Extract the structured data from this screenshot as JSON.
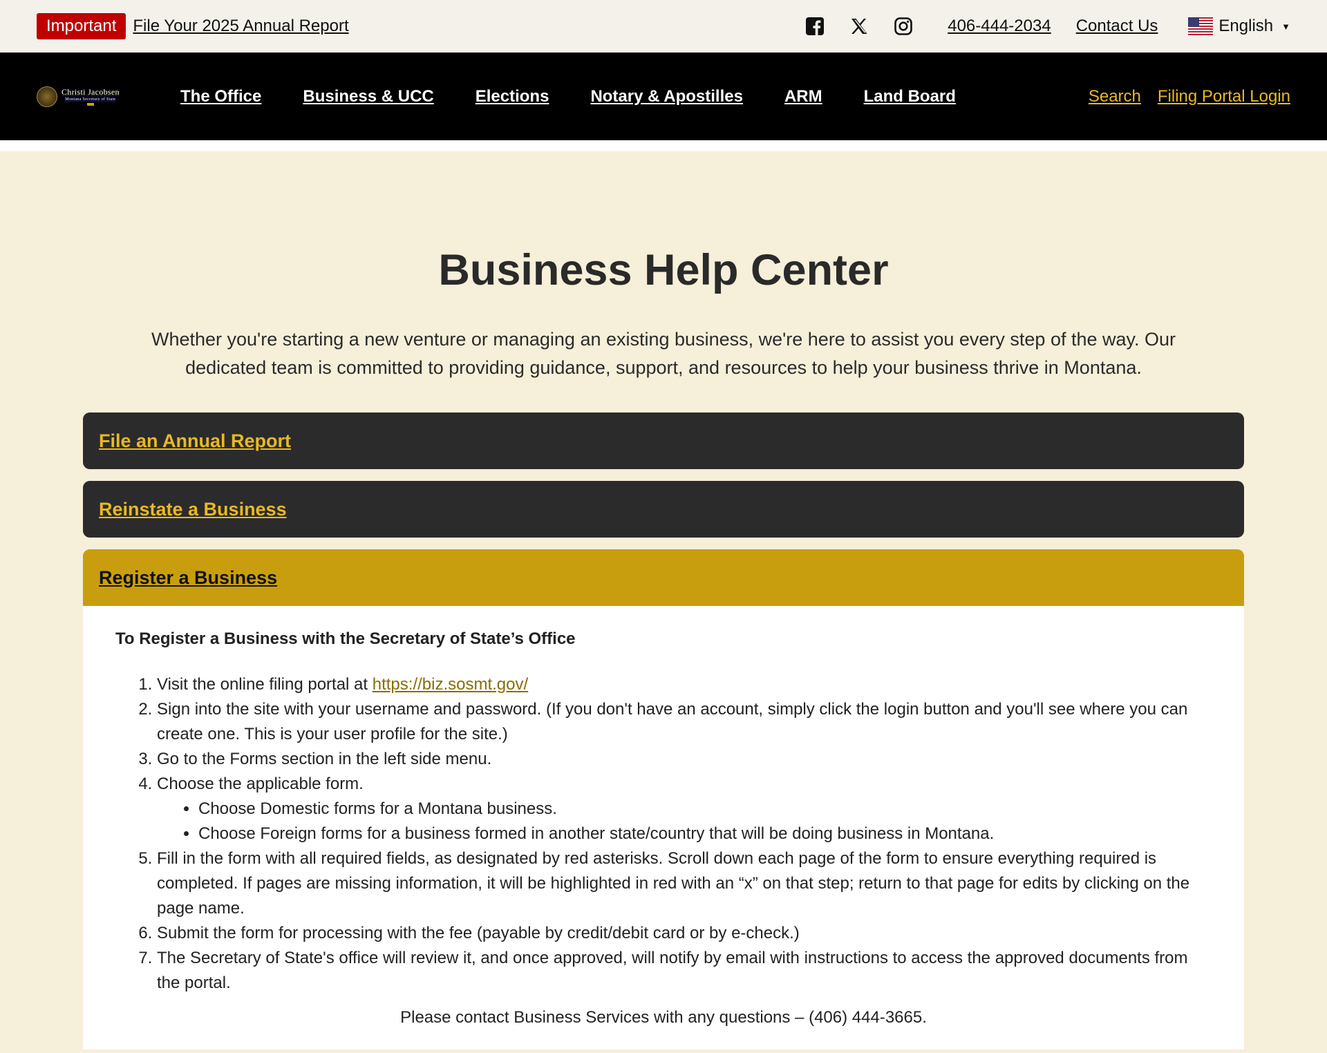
{
  "topbar": {
    "badge": "Important",
    "announcement": "File Your 2025 Annual Report",
    "phone": "406-444-2034",
    "contact": "Contact Us",
    "language": "English"
  },
  "logo": {
    "line1": "Christi Jacobsen",
    "line2": "Montana Secretary of State"
  },
  "nav": {
    "items": [
      "The Office",
      "Business & UCC",
      "Elections",
      "Notary & Apostilles",
      "ARM",
      "Land Board"
    ],
    "search": "Search",
    "portal": "Filing Portal Login"
  },
  "page": {
    "title": "Business Help Center",
    "intro": "Whether you're starting a new venture or managing an existing business, we're here to assist you every step of the way. Our dedicated team is committed to providing guidance, support, and resources to help your business thrive in Montana."
  },
  "accordion": {
    "items": [
      "File an Annual Report",
      "Reinstate a Business",
      "Register a Business"
    ]
  },
  "panel": {
    "heading": "To Register a Business with the Secretary of State’s Office",
    "step1_text": "Visit the online filing portal at ",
    "step1_link": "https://biz.sosmt.gov/",
    "step2": "Sign into the site with your username and password. (If you don't have an account, simply click the login button and you'll see where you can create one. This is your user profile for the site.)",
    "step3": "Go to the Forms section in the left side menu.",
    "step4": "Choose the applicable form.",
    "step4_sub1": "Choose Domestic forms for a Montana business.",
    "step4_sub2": "Choose Foreign forms for a business formed in another state/country that will be doing business in Montana.",
    "step5": "Fill in the form with all required fields, as designated by red asterisks.  Scroll down each page of the form to ensure everything required is completed.  If pages are missing information, it will be highlighted in red with an “x” on that step; return to that page for edits by clicking on the page name.",
    "step6": "Submit the form for processing with the fee (payable by credit/debit card or by e-check.)",
    "step7": "The Secretary of State's office will review it, and once approved, will notify by email with instructions to access the approved documents from the portal.",
    "contact_note": "Please contact Business Services with any questions – (406) 444-3665."
  },
  "colors": {
    "accent_gold": "#c99e0e",
    "link_gold": "#e8b923",
    "important_red": "#c00000",
    "dark_bar": "#2b2b2b"
  },
  "icons": [
    "facebook-icon",
    "x-icon",
    "instagram-icon",
    "us-flag-icon",
    "chevron-down-icon"
  ]
}
